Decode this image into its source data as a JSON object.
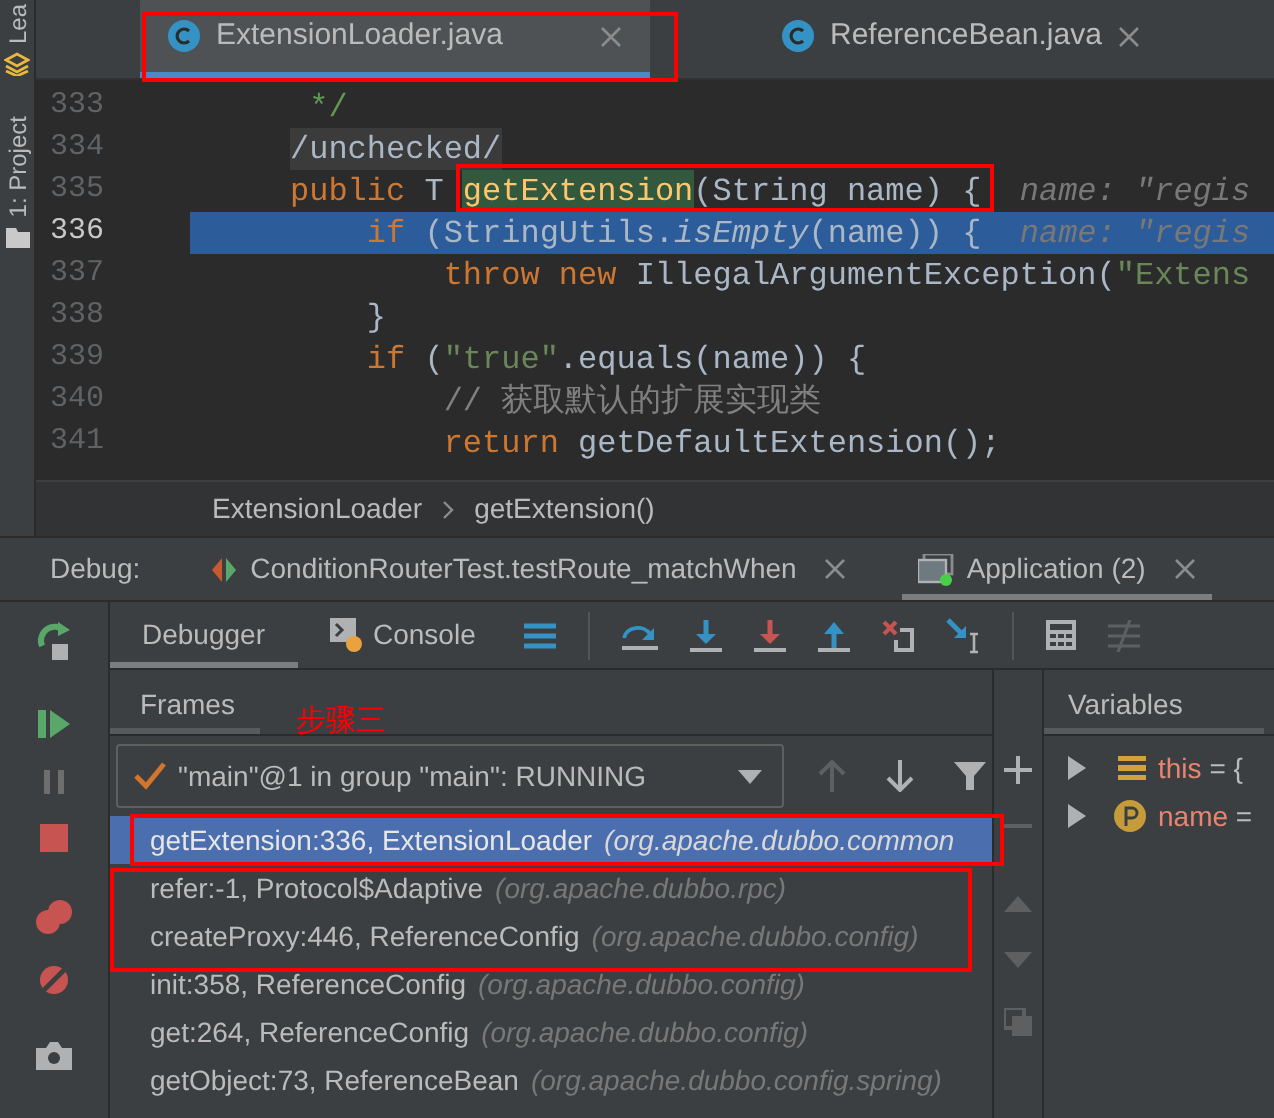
{
  "sidebar": {
    "items": [
      "Lea",
      "1: Project"
    ]
  },
  "editor_tabs": [
    {
      "label": "ExtensionLoader.java",
      "selected": true
    },
    {
      "label": "ReferenceBean.java",
      "selected": false
    }
  ],
  "code_lines": [
    {
      "number": "333",
      "current": false,
      "tokens": [
        {
          "kind": "doc",
          "text": " */"
        }
      ]
    },
    {
      "number": "334",
      "current": false,
      "tokens": [
        {
          "kind": "folded",
          "text": "/unchecked/"
        }
      ]
    },
    {
      "number": "335",
      "current": false,
      "tokens": [
        {
          "kind": "keyword",
          "text": "public"
        },
        {
          "kind": "plain",
          "text": " T "
        },
        {
          "kind": "match",
          "text": "getExtension"
        },
        {
          "kind": "plain",
          "text": "(String name) {"
        },
        {
          "kind": "hint",
          "text": "  name: \"regis"
        }
      ]
    },
    {
      "number": "336",
      "current": true,
      "tokens": [
        {
          "kind": "keyword",
          "text": "    if"
        },
        {
          "kind": "plain",
          "text": " (StringUtils."
        },
        {
          "kind": "static",
          "text": "isEmpty"
        },
        {
          "kind": "plain",
          "text": "(name)) {"
        },
        {
          "kind": "hint",
          "text": "  name: \"regis"
        }
      ]
    },
    {
      "number": "337",
      "current": false,
      "tokens": [
        {
          "kind": "keyword",
          "text": "        throw new"
        },
        {
          "kind": "plain",
          "text": " IllegalArgumentException("
        },
        {
          "kind": "string",
          "text": "\"Extens"
        }
      ]
    },
    {
      "number": "338",
      "current": false,
      "tokens": [
        {
          "kind": "plain",
          "text": "    }"
        }
      ]
    },
    {
      "number": "339",
      "current": false,
      "tokens": [
        {
          "kind": "keyword",
          "text": "    if"
        },
        {
          "kind": "plain",
          "text": " ("
        },
        {
          "kind": "string",
          "text": "\"true\""
        },
        {
          "kind": "plain",
          "text": ".equals(name)) {"
        }
      ]
    },
    {
      "number": "340",
      "current": false,
      "tokens": [
        {
          "kind": "comment",
          "text": "        // 获取默认的扩展实现类"
        }
      ]
    },
    {
      "number": "341",
      "current": false,
      "tokens": [
        {
          "kind": "keyword",
          "text": "        return"
        },
        {
          "kind": "plain",
          "text": " getDefaultExtension();"
        }
      ]
    }
  ],
  "breadcrumb": [
    "ExtensionLoader",
    "getExtension()"
  ],
  "debug": {
    "label": "Debug:",
    "sessions": [
      {
        "kind": "test",
        "label": "ConditionRouterTest.testRoute_matchWhen",
        "selected": false
      },
      {
        "kind": "app",
        "label": "Application (2)",
        "selected": true
      }
    ]
  },
  "debugger_tabs": [
    {
      "kind": "debugger",
      "label": "Debugger",
      "selected": true
    },
    {
      "kind": "console",
      "label": "Console",
      "selected": false
    }
  ],
  "frames": {
    "title": "Frames",
    "thread": "\"main\"@1 in group \"main\": RUNNING",
    "rows": [
      {
        "method": "getExtension:336, ExtensionLoader",
        "package": "(org.apache.dubbo.common",
        "selected": true
      },
      {
        "method": "refer:-1, Protocol$Adaptive",
        "package": "(org.apache.dubbo.rpc)",
        "selected": false
      },
      {
        "method": "createProxy:446, ReferenceConfig",
        "package": "(org.apache.dubbo.config)",
        "selected": false
      },
      {
        "method": "init:358, ReferenceConfig",
        "package": "(org.apache.dubbo.config)",
        "selected": false
      },
      {
        "method": "get:264, ReferenceConfig",
        "package": "(org.apache.dubbo.config)",
        "selected": false
      },
      {
        "method": "getObject:73, ReferenceBean",
        "package": "(org.apache.dubbo.config.spring)",
        "selected": false
      }
    ]
  },
  "variables": {
    "title": "Variables",
    "items": [
      {
        "kind": "object",
        "name": "this",
        "value": "= {"
      },
      {
        "kind": "param",
        "name": "name",
        "value": "="
      }
    ]
  },
  "annotation": "步骤三"
}
